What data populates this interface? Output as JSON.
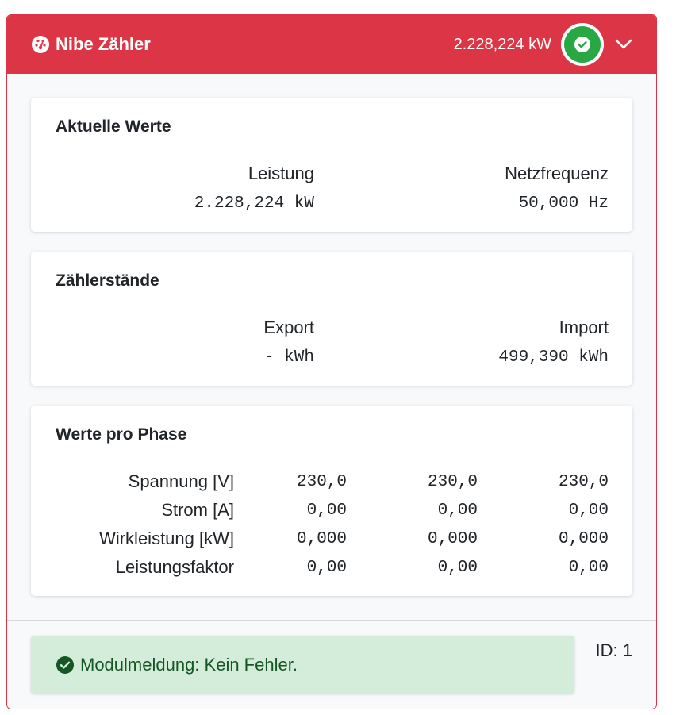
{
  "header": {
    "title": "Nibe Zähler",
    "power": "2.228,224 kW",
    "status_icon": "check-circle-icon",
    "toggle_icon": "chevron-down-icon",
    "accent_color": "#dc3545",
    "status_color": "#28a745"
  },
  "current_values": {
    "title": "Aktuelle Werte",
    "leistung_label": "Leistung",
    "leistung_value": "2.228,224 kW",
    "netzfrequenz_label": "Netzfrequenz",
    "netzfrequenz_value": "50,000 Hz"
  },
  "meter_readings": {
    "title": "Zählerstände",
    "export_label": "Export",
    "export_value": "- kWh",
    "import_label": "Import",
    "import_value": "499,390 kWh"
  },
  "phase_values": {
    "title": "Werte pro Phase",
    "rows": [
      {
        "label": "Spannung [V]",
        "values": [
          "230,0",
          "230,0",
          "230,0"
        ]
      },
      {
        "label": "Strom [A]",
        "values": [
          "0,00",
          "0,00",
          "0,00"
        ]
      },
      {
        "label": "Wirkleistung [kW]",
        "values": [
          "0,000",
          "0,000",
          "0,000"
        ]
      },
      {
        "label": "Leistungsfaktor",
        "values": [
          "0,00",
          "0,00",
          "0,00"
        ]
      }
    ]
  },
  "footer": {
    "module_message": "Modulmeldung: Kein Fehler.",
    "id_label": "ID: 1"
  }
}
